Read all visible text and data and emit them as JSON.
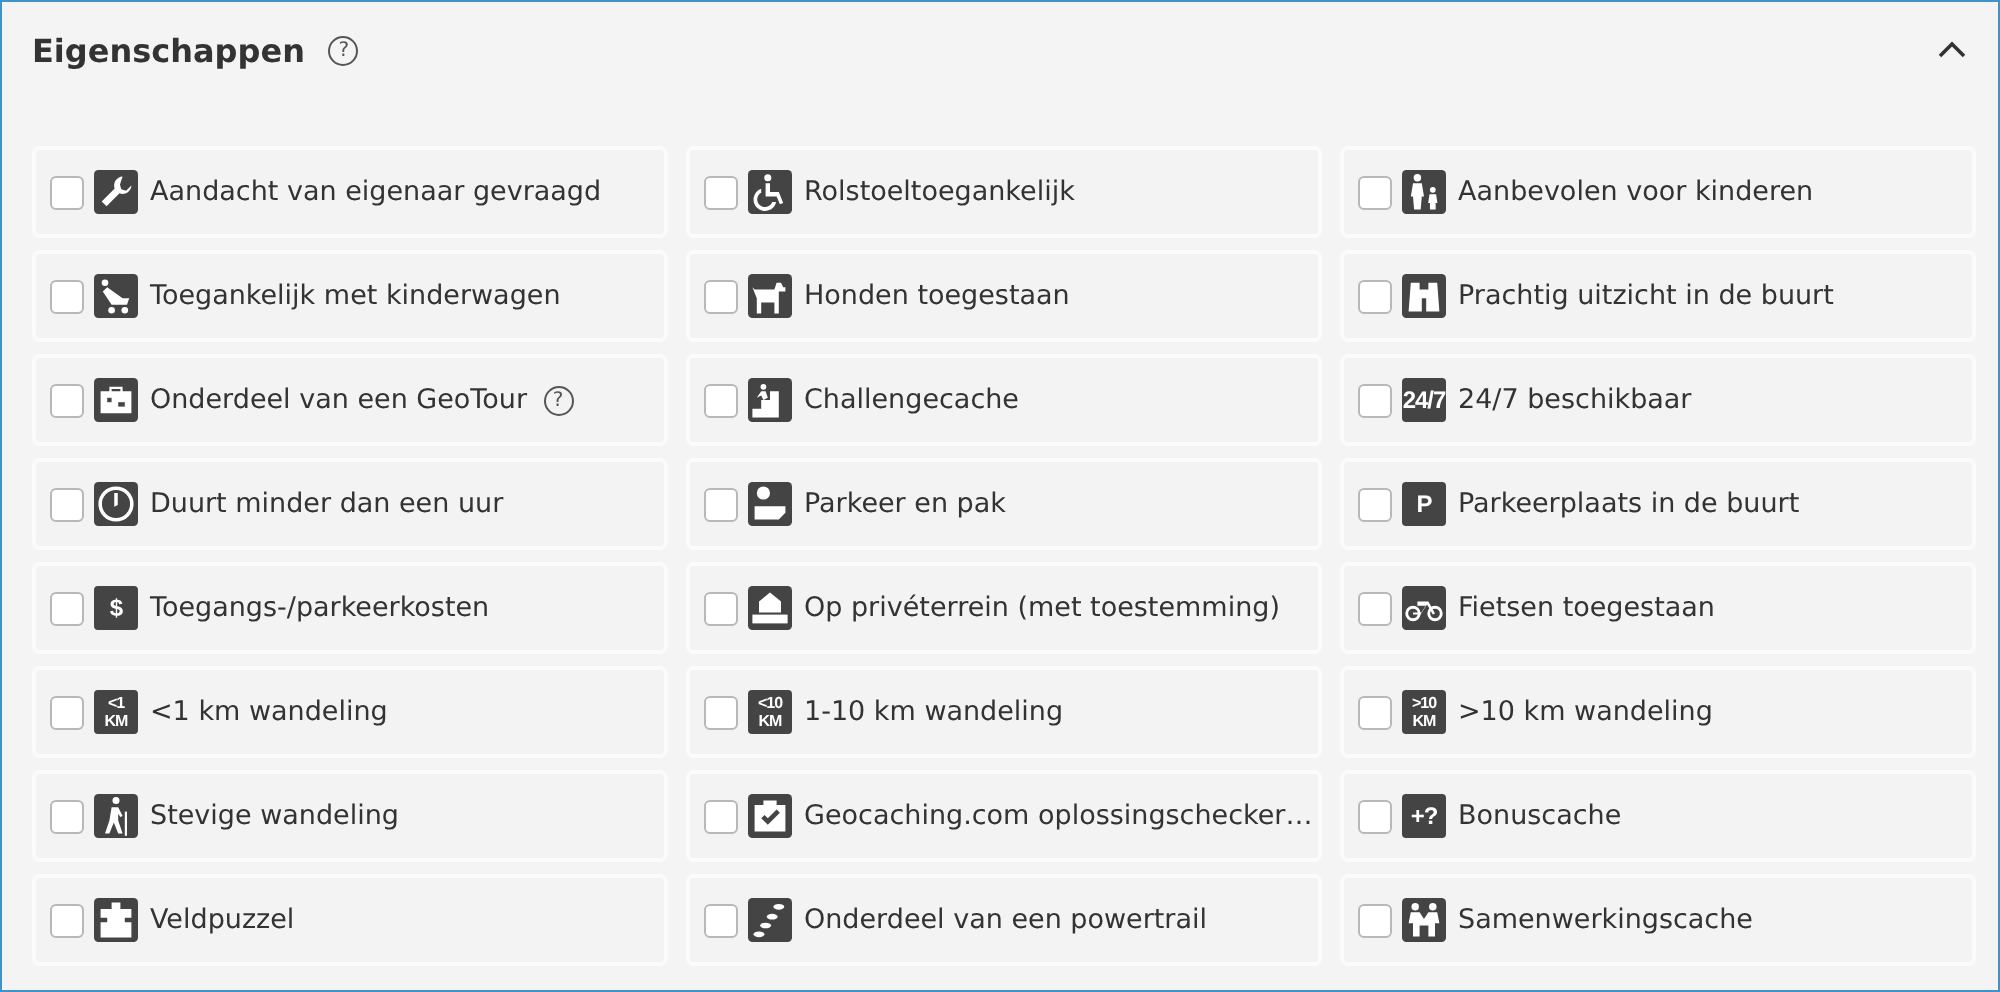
{
  "section": {
    "title": "Eigenschappen",
    "help": "?",
    "expanded": true
  },
  "attributes": [
    {
      "label": "Aandacht van eigenaar gevraagd",
      "kind": "wrench",
      "checked": false
    },
    {
      "label": "Rolstoeltoegankelijk",
      "kind": "wheelchair",
      "checked": false
    },
    {
      "label": "Aanbevolen voor kinderen",
      "kind": "family",
      "checked": false
    },
    {
      "label": "Toegankelijk met kinderwagen",
      "kind": "stroller",
      "checked": false
    },
    {
      "label": "Honden toegestaan",
      "kind": "dog",
      "checked": false
    },
    {
      "label": "Prachtig uitzicht in de buurt",
      "kind": "binoculars",
      "checked": false
    },
    {
      "label": "Onderdeel van een GeoTour",
      "kind": "suitcase",
      "checked": false,
      "help": "?"
    },
    {
      "label": "Challengecache",
      "kind": "stairs",
      "checked": false
    },
    {
      "label": "24/7 beschikbaar",
      "kind": "text",
      "icon_text": [
        "24/7"
      ],
      "checked": false
    },
    {
      "label": "Duurt minder dan een uur",
      "kind": "clock",
      "checked": false
    },
    {
      "label": "Parkeer en pak",
      "kind": "parkgrab",
      "checked": false
    },
    {
      "label": "Parkeerplaats in de buurt",
      "kind": "text",
      "icon_text": [
        "P"
      ],
      "checked": false
    },
    {
      "label": "Toegangs-/parkeerkosten",
      "kind": "text",
      "icon_text": [
        "$"
      ],
      "checked": false
    },
    {
      "label": "Op privéterrein (met toestemming)",
      "kind": "house",
      "checked": false
    },
    {
      "label": "Fietsen toegestaan",
      "kind": "bike",
      "checked": false
    },
    {
      "label": "<1 km wandeling",
      "kind": "text",
      "icon_text": [
        "<1",
        "KM"
      ],
      "checked": false
    },
    {
      "label": "1-10 km wandeling",
      "kind": "text",
      "icon_text": [
        "<10",
        "KM"
      ],
      "checked": false
    },
    {
      "label": ">10 km wandeling",
      "kind": "text",
      "icon_text": [
        ">10",
        "KM"
      ],
      "checked": false
    },
    {
      "label": "Stevige wandeling",
      "kind": "hiker",
      "checked": false
    },
    {
      "label": "Geocaching.com oplossingschecker…",
      "kind": "checker",
      "checked": false
    },
    {
      "label": "Bonuscache",
      "kind": "text",
      "icon_text": [
        "+?"
      ],
      "checked": false
    },
    {
      "label": "Veldpuzzel",
      "kind": "puzzle",
      "checked": false
    },
    {
      "label": "Onderdeel van een powertrail",
      "kind": "trail",
      "checked": false
    },
    {
      "label": "Samenwerkingscache",
      "kind": "team",
      "checked": false
    }
  ]
}
